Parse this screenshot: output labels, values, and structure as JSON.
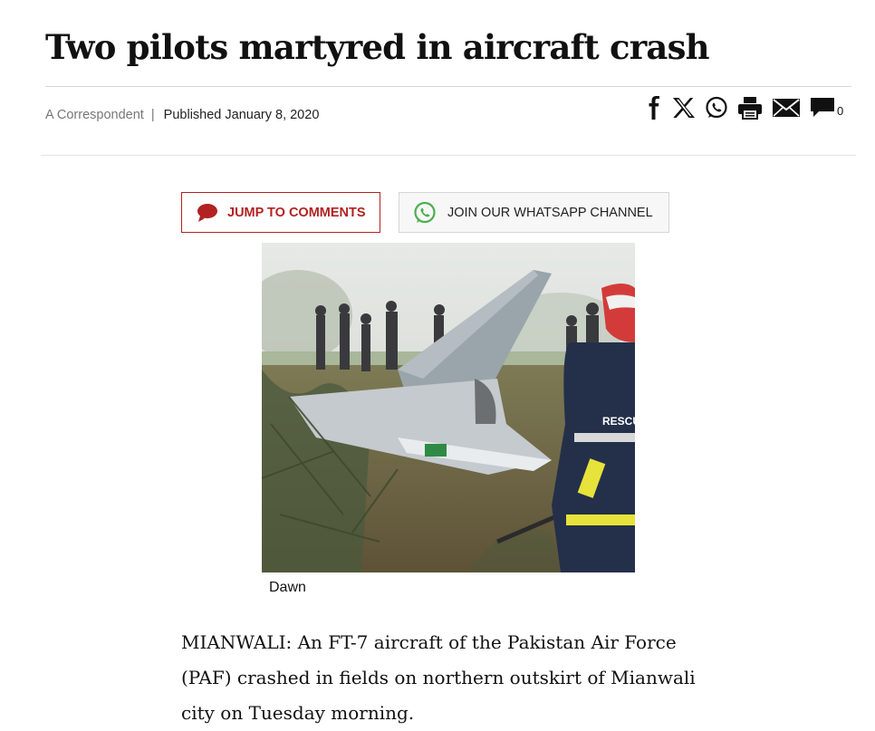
{
  "article": {
    "headline": "Two pilots martyred in aircraft crash",
    "author": "A Correspondent",
    "separator": "|",
    "published": "Published January 8, 2020",
    "comment_count": "0"
  },
  "share_icons": [
    "facebook-icon",
    "x-icon",
    "whatsapp-icon",
    "print-icon",
    "email-icon",
    "comment-icon"
  ],
  "buttons": {
    "jump_to_comments": "JUMP TO COMMENTS",
    "whatsapp_channel": "JOIN OUR WHATSAPP CHANNEL"
  },
  "image": {
    "caption": "Dawn",
    "rescue_text": "RESCUE"
  },
  "body": {
    "paragraph_1": "MIANWALI: An FT-7 aircraft of the Pakistan Air Force (PAF) crashed in fields on northern outskirt of Mianwali city on Tuesday morning."
  },
  "colors": {
    "accent_red": "#b22222",
    "whatsapp_green": "#4caf50",
    "rule": "#d8d8d8"
  }
}
